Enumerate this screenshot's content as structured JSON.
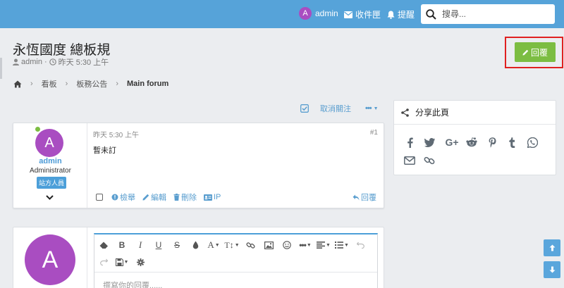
{
  "navbar": {
    "username": "admin",
    "avatar_letter": "A",
    "inbox_label": "收件匣",
    "notifications_label": "提醒",
    "search_placeholder": "搜尋..."
  },
  "thread": {
    "title": "永恆國度 總板規",
    "author": "admin",
    "time": "昨天 5:30 上午",
    "reply_button_label": "回覆"
  },
  "breadcrumb": {
    "items": [
      "看板",
      "板務公告",
      "Main forum"
    ]
  },
  "topic_tools": {
    "unfollow_label": "取消關注"
  },
  "post": {
    "avatar_letter": "A",
    "username": "admin",
    "role": "Administrator",
    "badge": "站方人員",
    "time": "昨天 5:30 上午",
    "number": "#1",
    "content": "暫未訂",
    "actions": {
      "report": "檢舉",
      "edit": "編輯",
      "delete": "刪除",
      "ip": "IP",
      "reply": "回覆"
    }
  },
  "share_widget": {
    "title": "分享此頁",
    "icons": [
      "facebook-icon",
      "twitter-icon",
      "google-plus-icon",
      "reddit-icon",
      "pinterest-icon",
      "tumblr-icon",
      "whatsapp-icon",
      "email-icon",
      "link-icon"
    ]
  },
  "reply_editor": {
    "avatar_letter": "A",
    "placeholder": "撰寫你的回覆......"
  },
  "colors": {
    "navbar": "#56a3d9",
    "accent": "#4c9fd9",
    "reply_button": "#7cbd42",
    "avatar": "#a94dc1",
    "highlight_box": "#e02020"
  }
}
